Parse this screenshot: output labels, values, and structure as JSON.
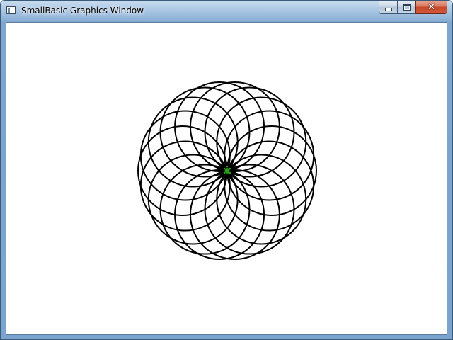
{
  "window": {
    "title": "SmallBasic Graphics Window",
    "minimize_icon": "minimize-icon",
    "maximize_icon": "maximize-icon",
    "close_icon": "close-icon",
    "close_glyph": "✕"
  },
  "canvas": {
    "background": "#ffffff",
    "pattern": {
      "type": "circle-rosette",
      "circle_count": 18,
      "stroke_color": "#000000"
    },
    "turtle": {
      "color": "#2e9e1a"
    }
  }
}
